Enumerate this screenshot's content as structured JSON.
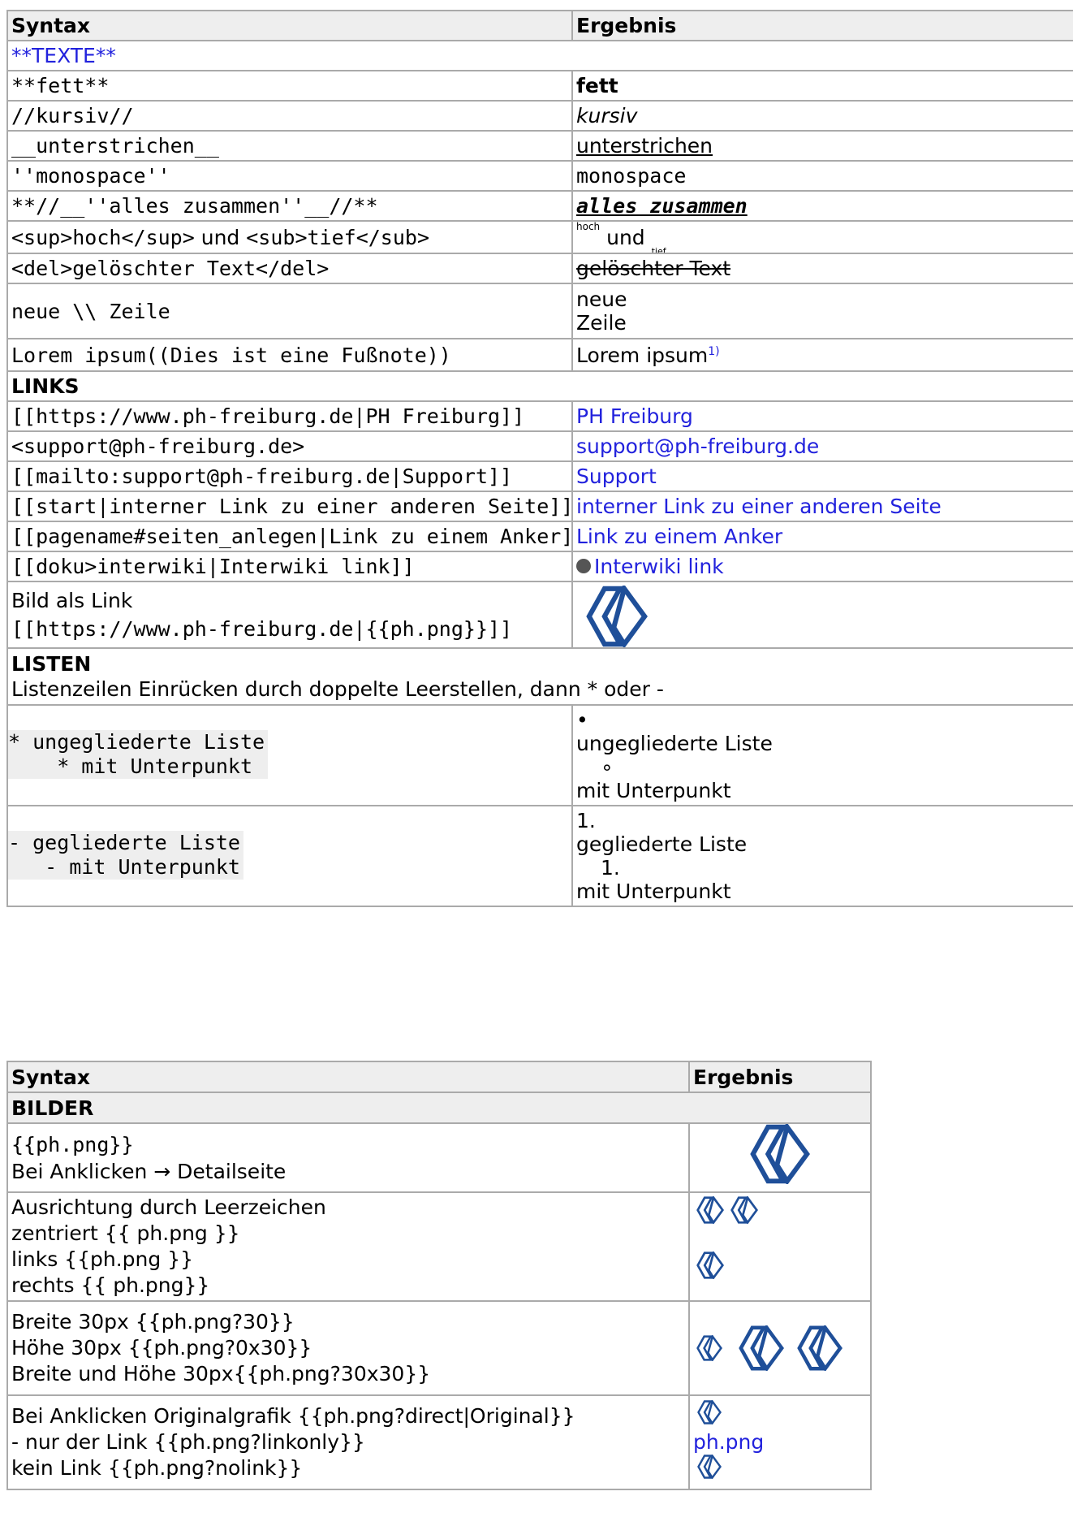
{
  "t1": {
    "header": {
      "syntax": "Syntax",
      "result": "Ergebnis"
    },
    "texte_link": "**TEXTE**",
    "rows_text": [
      {
        "s": "**fett**",
        "r": "fett"
      },
      {
        "s": "//kursiv//",
        "r": "kursiv"
      },
      {
        "s": "__unterstrichen__",
        "r": "unterstrichen"
      },
      {
        "s": "''monospace''",
        "r": "monospace"
      },
      {
        "s": "**//__''alles zusammen''__//**",
        "r": "alles zusammen"
      },
      {
        "s1": "<sup>hoch</sup>",
        "s2": " und ",
        "s3": "<sub>tief</sub>",
        "r_hoch": "hoch",
        "r_und": " und ",
        "r_tief": "tief"
      },
      {
        "s": "<del>gelöschter Text</del>",
        "r": "gelöschter Text"
      },
      {
        "s": "neue \\\\ Zeile",
        "r1": "neue",
        "r2": "Zeile"
      },
      {
        "s": "Lorem ipsum((Dies ist eine Fußnote))",
        "r": "Lorem ipsum",
        "fn": "1)"
      }
    ],
    "links_title": "LINKS",
    "rows_links": [
      {
        "s": "[[https://www.ph-freiburg.de|PH Freiburg]]",
        "r": "PH Freiburg"
      },
      {
        "s": "<support@ph-freiburg.de>",
        "r": "support@ph-freiburg.de"
      },
      {
        "s": "[[mailto:support@ph-freiburg.de|Support]]",
        "r": "Support"
      },
      {
        "s": "[[start|interner Link zu einer anderen Seite]]",
        "r": "interner Link zu einer anderen Seite"
      },
      {
        "s": "[[pagename#seiten_anlegen|Link zu einem Anker]]",
        "r": "Link zu einem Anker"
      },
      {
        "s": "[[doku>interwiki|Interwiki link]]",
        "r": "Interwiki link"
      },
      {
        "s1": "Bild als Link",
        "s2": "[[https://www.ph-freiburg.de|{{ph.png}}]]"
      }
    ],
    "listen_title": "LISTEN",
    "listen_desc": "Listenzeilen Einrücken durch doppelte Leerstellen, dann * oder -",
    "ul": {
      "c1": "* ungegliederte Liste",
      "c2": "    * mit Unterpunkt",
      "b1": "•",
      "i1": "ungegliederte Liste",
      "b2": "∘",
      "i2": "mit Unterpunkt"
    },
    "ol": {
      "c1": "- gegliederte Liste",
      "c2": "   - mit Unterpunkt",
      "n1": "1.",
      "i1": "gegliederte Liste",
      "n2": "1.",
      "i2": "mit Unterpunkt"
    }
  },
  "t2": {
    "header": {
      "syntax": "Syntax",
      "result": "Ergebnis"
    },
    "bilder_title": "BILDER",
    "r1": {
      "a": "{{ph.png}}",
      "b": "Bei Anklicken → Detailseite"
    },
    "r2": {
      "a": "Ausrichtung durch Leerzeichen",
      "b": "zentriert {{ ph.png }}",
      "c": "links {{ph.png }}",
      "d": "rechts {{ ph.png}}"
    },
    "r3": {
      "a": "Breite 30px {{ph.png?30}}",
      "b": "Höhe 30px {{ph.png?0x30}}",
      "c": "Breite und Höhe 30px{{ph.png?30x30}}"
    },
    "r4": {
      "a": "Bei Anklicken Originalgrafik {{ph.png?direct|Original}}",
      "b": "- nur der Link {{ph.png?linkonly}}",
      "c": "kein Link {{ph.png?nolink}}",
      "link": "ph.png"
    }
  },
  "colors": {
    "link": "#2222dd",
    "logo": "#1f4f99",
    "border": "#aaaaaa",
    "header_bg": "#eeeeee"
  }
}
